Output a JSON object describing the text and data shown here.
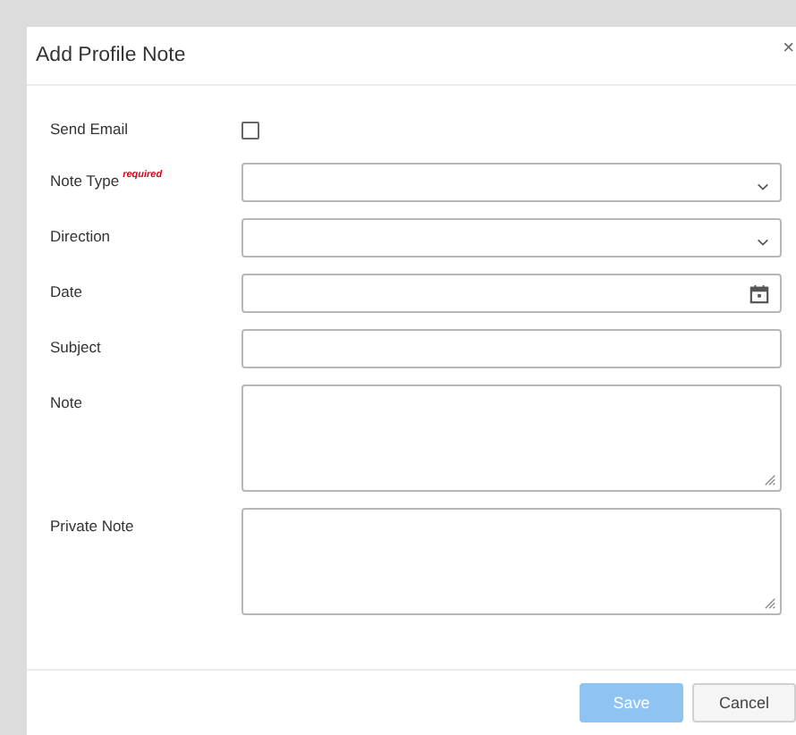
{
  "dialog": {
    "title": "Add Profile Note",
    "close": "×"
  },
  "fields": [
    {
      "kind": "checkbox",
      "label": "Send Email",
      "checked": false
    },
    {
      "kind": "select",
      "label": "Note Type",
      "required": "required"
    },
    {
      "kind": "select",
      "label": "Direction"
    },
    {
      "kind": "date",
      "label": "Date"
    },
    {
      "kind": "text",
      "label": "Subject"
    },
    {
      "kind": "textarea",
      "label": "Note"
    },
    {
      "kind": "textarea",
      "label": "Private Note"
    }
  ],
  "buttons": [
    {
      "kind": "primary",
      "label": "Save",
      "disabled": true
    },
    {
      "kind": "secondary",
      "label": "Cancel",
      "disabled": false
    }
  ]
}
